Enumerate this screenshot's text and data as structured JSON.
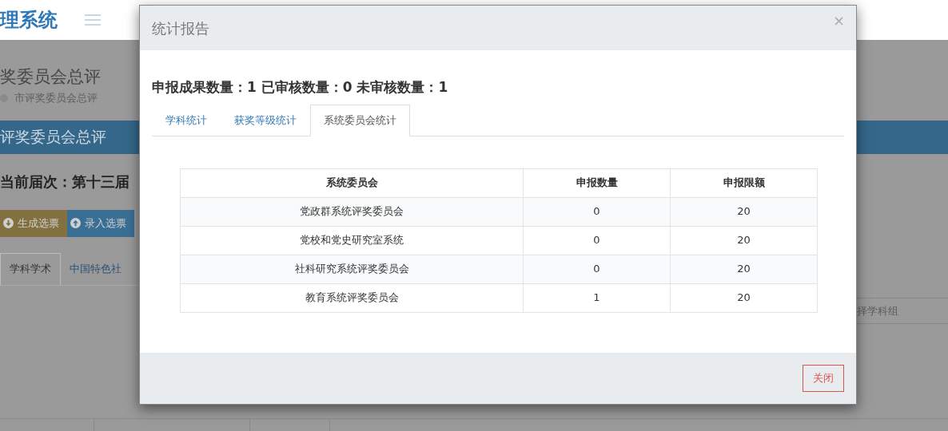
{
  "app": {
    "title": "理系统"
  },
  "page": {
    "title": "奖委员会总评",
    "breadcrumb": "市评奖委员会总评",
    "section_bar": "评奖委员会总评",
    "session": "当前届次：第十三届",
    "buttons": [
      {
        "label": "生成选票",
        "kind": "generate"
      },
      {
        "label": "录入选票",
        "kind": "import"
      }
    ],
    "tabs": [
      {
        "label": "学科学术",
        "selected": true
      },
      {
        "label": "中国特色社",
        "selected": false
      }
    ],
    "subject_select": {
      "value": "择学科组"
    }
  },
  "modal": {
    "title": "统计报告",
    "close": "×",
    "summary": "申报成果数量：1 已审核数量：0 未审核数量：1",
    "tabs": [
      {
        "label": "学科统计",
        "selected": false
      },
      {
        "label": "获奖等级统计",
        "selected": false
      },
      {
        "label": "系统委员会统计",
        "selected": true
      }
    ],
    "table": {
      "columns": [
        "系统委员会",
        "申报数量",
        "申报限额"
      ],
      "rows": [
        [
          "党政群系统评奖委员会",
          "0",
          "20"
        ],
        [
          "党校和党史研究室系统",
          "0",
          "20"
        ],
        [
          "社科研究系统评奖委员会",
          "0",
          "20"
        ],
        [
          "教育系统评奖委员会",
          "1",
          "20"
        ]
      ]
    },
    "footer_button": "关闭"
  }
}
